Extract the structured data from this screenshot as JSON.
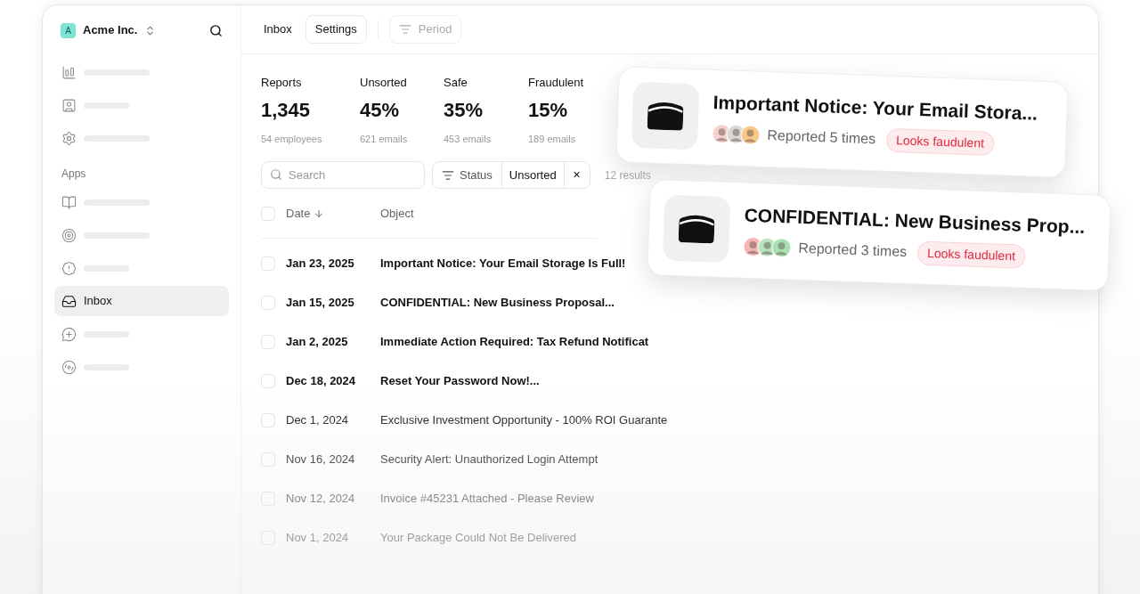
{
  "workspace": {
    "avatar": "A",
    "name": "Acme Inc."
  },
  "sidebar": {
    "section_label": "Apps",
    "top_items": [
      {
        "kind": "skeleton",
        "selected": false
      },
      {
        "kind": "skeleton",
        "selected": false
      },
      {
        "kind": "skeleton",
        "selected": false
      }
    ],
    "app_items": [
      {
        "kind": "skeleton",
        "selected": false
      },
      {
        "kind": "skeleton",
        "selected": false
      },
      {
        "kind": "skeleton",
        "selected": false
      },
      {
        "kind": "label",
        "label": "Inbox",
        "selected": true
      },
      {
        "kind": "skeleton",
        "selected": false
      },
      {
        "kind": "skeleton",
        "selected": false
      }
    ]
  },
  "breadcrumbs": [
    {
      "label": "Inbox",
      "selected": false
    },
    {
      "label": "Settings",
      "selected": true
    }
  ],
  "period_button": "Period",
  "stats": [
    {
      "label": "Reports",
      "value": "1,345",
      "note": "54 employees"
    },
    {
      "label": "Unsorted",
      "value": "45%",
      "note": "621 emails"
    },
    {
      "label": "Safe",
      "value": "35%",
      "note": "453 emails"
    },
    {
      "label": "Fraudulent",
      "value": "15%",
      "note": "189 emails"
    }
  ],
  "search": {
    "placeholder": "Search"
  },
  "filter": {
    "label": "Status",
    "value": "Unsorted",
    "clear": "×"
  },
  "results": "12 results",
  "table": {
    "columns": [
      "Date",
      "Object"
    ],
    "all_checked": false,
    "rows": [
      {
        "date": "Jan 23, 2025",
        "object": "Important Notice: Your Email Storage Is Full!",
        "unread": true,
        "checked": false
      },
      {
        "date": "Jan 15, 2025",
        "object": "CONFIDENTIAL: New Business Proposal...",
        "unread": true,
        "checked": false
      },
      {
        "date": "Jan 2, 2025",
        "object": "Immediate Action Required: Tax Refund Notificat",
        "unread": true,
        "checked": false
      },
      {
        "date": "Dec 18, 2024",
        "object": "Reset Your Password Now!...",
        "unread": true,
        "checked": false
      },
      {
        "date": "Dec 1, 2024",
        "object": "Exclusive Investment Opportunity - 100% ROI Guarante",
        "unread": false,
        "checked": false
      },
      {
        "date": "Nov 16, 2024",
        "object": "Security Alert: Unauthorized Login Attempt",
        "unread": false,
        "checked": false
      },
      {
        "date": "Nov 12, 2024",
        "object": "Invoice #45231 Attached - Please Review",
        "unread": false,
        "checked": false
      },
      {
        "date": "Nov 1, 2024",
        "object": "Your Package Could Not Be Delivered",
        "unread": false,
        "checked": false
      }
    ]
  },
  "cards": [
    {
      "title": "Important Notice: Your Email Stora...",
      "reported": "Reported 5 times",
      "tag": "Looks faudulent",
      "avatars": [
        {
          "color": "#f5d0d0"
        },
        {
          "color": "#d9d9d9"
        },
        {
          "color": "#f8c98a"
        }
      ]
    },
    {
      "title": "CONFIDENTIAL: New Business Prop...",
      "reported": "Reported 3 times",
      "tag": "Looks faudulent",
      "avatars": [
        {
          "color": "#f7b4b4"
        },
        {
          "color": "#b7e4c0"
        },
        {
          "color": "#a8e0b4"
        }
      ]
    }
  ]
}
